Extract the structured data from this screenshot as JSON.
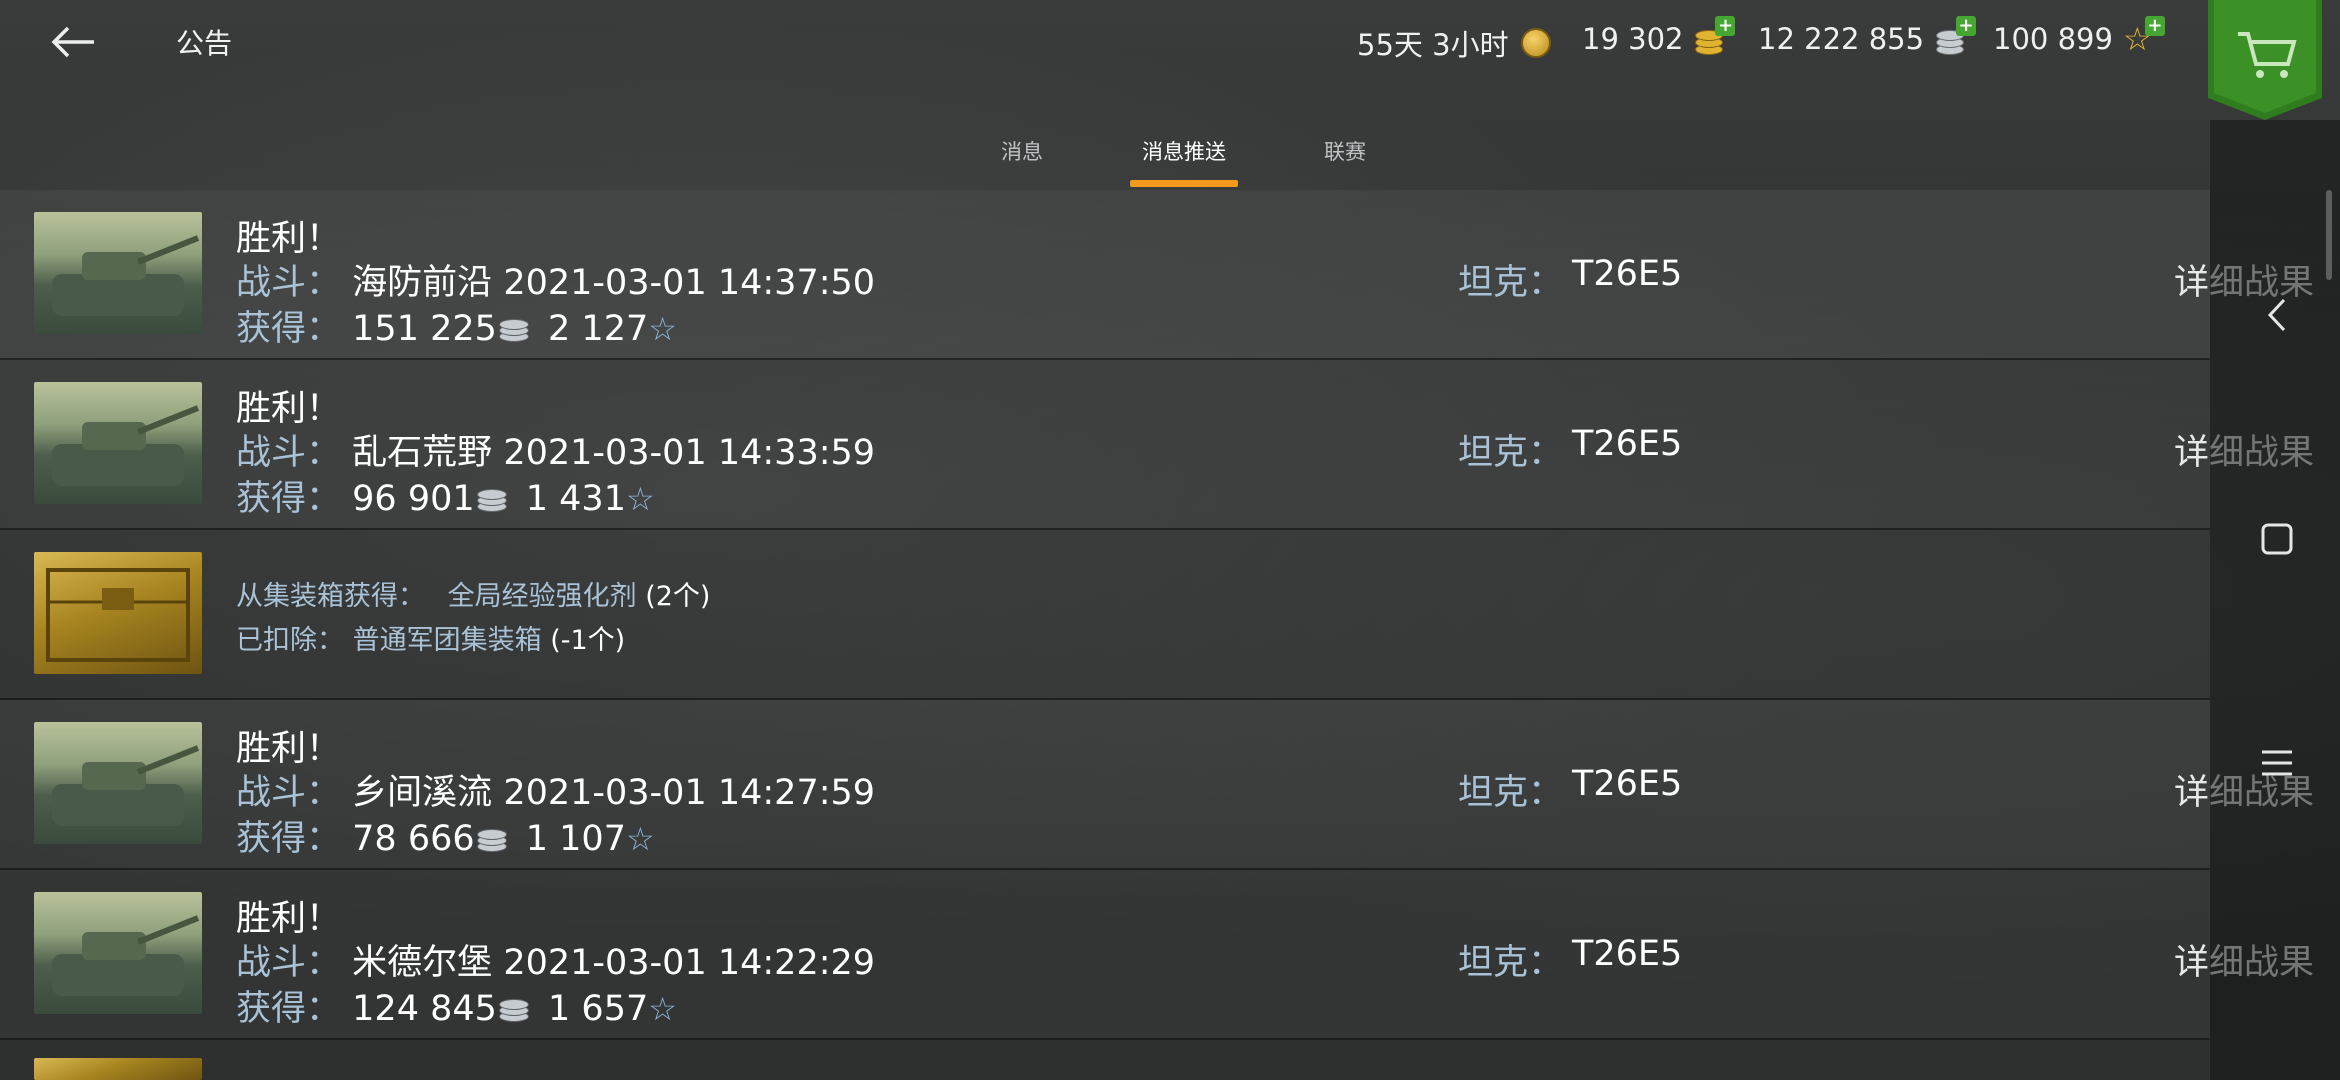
{
  "header": {
    "title": "公告",
    "resources": {
      "premium_time": "55天 3小时",
      "gold": "19 302",
      "credits": "12 222 855",
      "free_xp": "100 899"
    }
  },
  "tabs": [
    {
      "label": "消息",
      "active": false
    },
    {
      "label": "消息推送",
      "active": true
    },
    {
      "label": "联赛",
      "active": false
    }
  ],
  "labels": {
    "battle": "战斗：",
    "reward": "获得：",
    "tank": "坦克：",
    "details": "详细战果",
    "from_crate": "从集装箱获得：",
    "deducted": "已扣除："
  },
  "messages": [
    {
      "result": "胜利！",
      "map": "海防前沿",
      "datetime": "2021-03-01 14:37:50",
      "credits": "151 225",
      "xp": "2 127",
      "tank": "T26E5"
    },
    {
      "result": "胜利！",
      "map": "乱石荒野",
      "datetime": "2021-03-01 14:33:59",
      "credits": "96 901",
      "xp": "1 431",
      "tank": "T26E5"
    },
    {
      "result": "胜利！",
      "map": "乡间溪流",
      "datetime": "2021-03-01 14:27:59",
      "credits": "78 666",
      "xp": "1 107",
      "tank": "T26E5"
    },
    {
      "result": "胜利！",
      "map": "米德尔堡",
      "datetime": "2021-03-01 14:22:29",
      "credits": "124 845",
      "xp": "1 657",
      "tank": "T26E5"
    }
  ],
  "crate_message": {
    "item": "全局经验强化剂",
    "item_count": "(2个)",
    "removed_item": "普通军团集装箱",
    "removed_count": "(-1个)"
  },
  "icons": {
    "back": "back-arrow-icon",
    "cart": "shopping-cart-icon",
    "nav_back": "chevron-left-icon",
    "nav_home": "square-icon",
    "nav_menu": "menu-icon"
  },
  "colors": {
    "accent_tab": "#f29a1c",
    "label_blue": "#a9c2d6",
    "cart_green": "#2f7d1e",
    "plus_green": "#46a632"
  }
}
